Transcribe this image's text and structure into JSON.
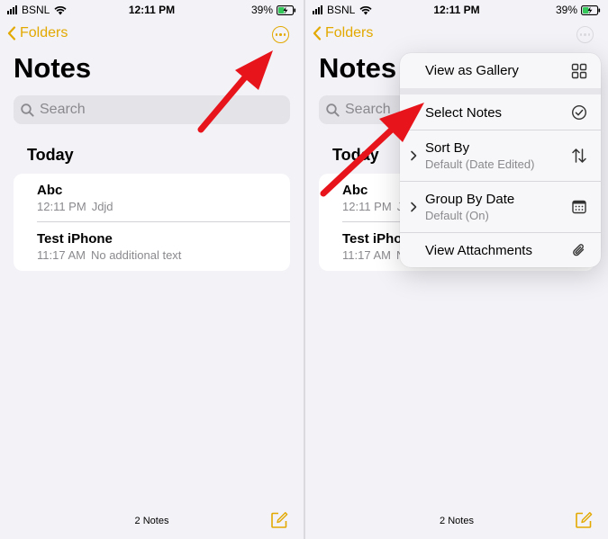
{
  "status_bar": {
    "carrier": "BSNL",
    "time": "12:11 PM",
    "battery": "39%"
  },
  "nav": {
    "back_label": "Folders"
  },
  "title": "Notes",
  "search": {
    "placeholder": "Search"
  },
  "section": "Today",
  "notes": [
    {
      "title": "Abc",
      "time": "12:11 PM",
      "preview": "Jdjd"
    },
    {
      "title": "Test iPhone",
      "time": "11:17 AM",
      "preview": "No additional text"
    }
  ],
  "footer": {
    "count": "2 Notes"
  },
  "menu": {
    "view_gallery": "View as Gallery",
    "select_notes": "Select Notes",
    "sort_by": {
      "label": "Sort By",
      "value": "Default (Date Edited)"
    },
    "group_by": {
      "label": "Group By Date",
      "value": "Default (On)"
    },
    "attachments": "View Attachments"
  },
  "colors": {
    "accent": "#e3a900",
    "arrow": "#e8141b",
    "background": "#f2f2f7"
  }
}
